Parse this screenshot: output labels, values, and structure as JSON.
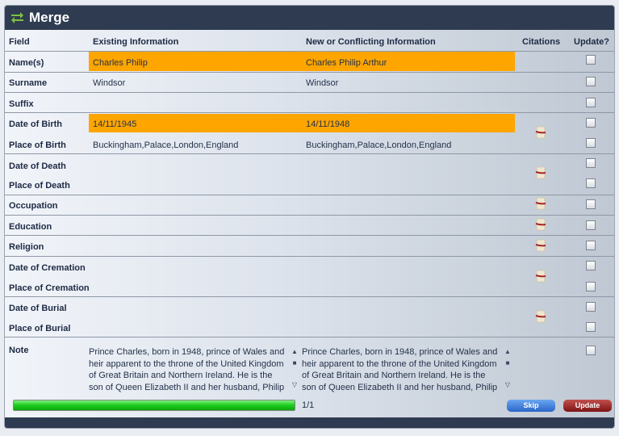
{
  "window": {
    "title": "Merge",
    "icon": "swap-arrows-icon"
  },
  "columns": {
    "field": "Field",
    "existing": "Existing Information",
    "new": "New or Conflicting Information",
    "citations": "Citations",
    "update": "Update?"
  },
  "rows": [
    {
      "field": "Name(s)",
      "existing": "Charles Philip",
      "new": "Charles Philip Arthur",
      "conflict": true
    },
    {
      "field": "Surname",
      "existing": "Windsor",
      "new": "Windsor"
    },
    {
      "field": "Suffix",
      "existing": "",
      "new": ""
    },
    {
      "field": "Date of Birth",
      "existing": "14/11/1945",
      "new": "14/11/1948",
      "conflict": true
    },
    {
      "field": "Place of Birth",
      "existing": "Buckingham,Palace,London,England",
      "new": "Buckingham,Palace,London,England"
    },
    {
      "field": "Date of Death",
      "existing": "",
      "new": ""
    },
    {
      "field": "Place of Death",
      "existing": "",
      "new": ""
    },
    {
      "field": "Occupation",
      "existing": "",
      "new": ""
    },
    {
      "field": "Education",
      "existing": "",
      "new": ""
    },
    {
      "field": "Religion",
      "existing": "",
      "new": ""
    },
    {
      "field": "Date of Cremation",
      "existing": "",
      "new": ""
    },
    {
      "field": "Place of Cremation",
      "existing": "",
      "new": ""
    },
    {
      "field": "Date of Burial",
      "existing": "",
      "new": ""
    },
    {
      "field": "Place of Burial",
      "existing": "",
      "new": ""
    }
  ],
  "note": {
    "field": "Note",
    "existing": "Prince Charles, born in 1948, prince of Wales and heir apparent to the throne of the United Kingdom of Great Britain and Northern Ireland. He is the son of Queen Elizabeth II and her husband, Philip",
    "new": "Prince Charles, born in 1948, prince of Wales and heir apparent to the throne of the United Kingdom of Great Britain and Northern Ireland. He is the son of Queen Elizabeth II and her husband, Philip"
  },
  "progress": {
    "fraction": 1.0,
    "label": "1/1"
  },
  "buttons": {
    "skip": "Skip",
    "update": "Update"
  },
  "colors": {
    "conflict": "#ffa500",
    "titlebar": "#2f3b50",
    "progress": "#22cc22",
    "skip": "#2f6fcf",
    "update": "#9a1f1f"
  }
}
